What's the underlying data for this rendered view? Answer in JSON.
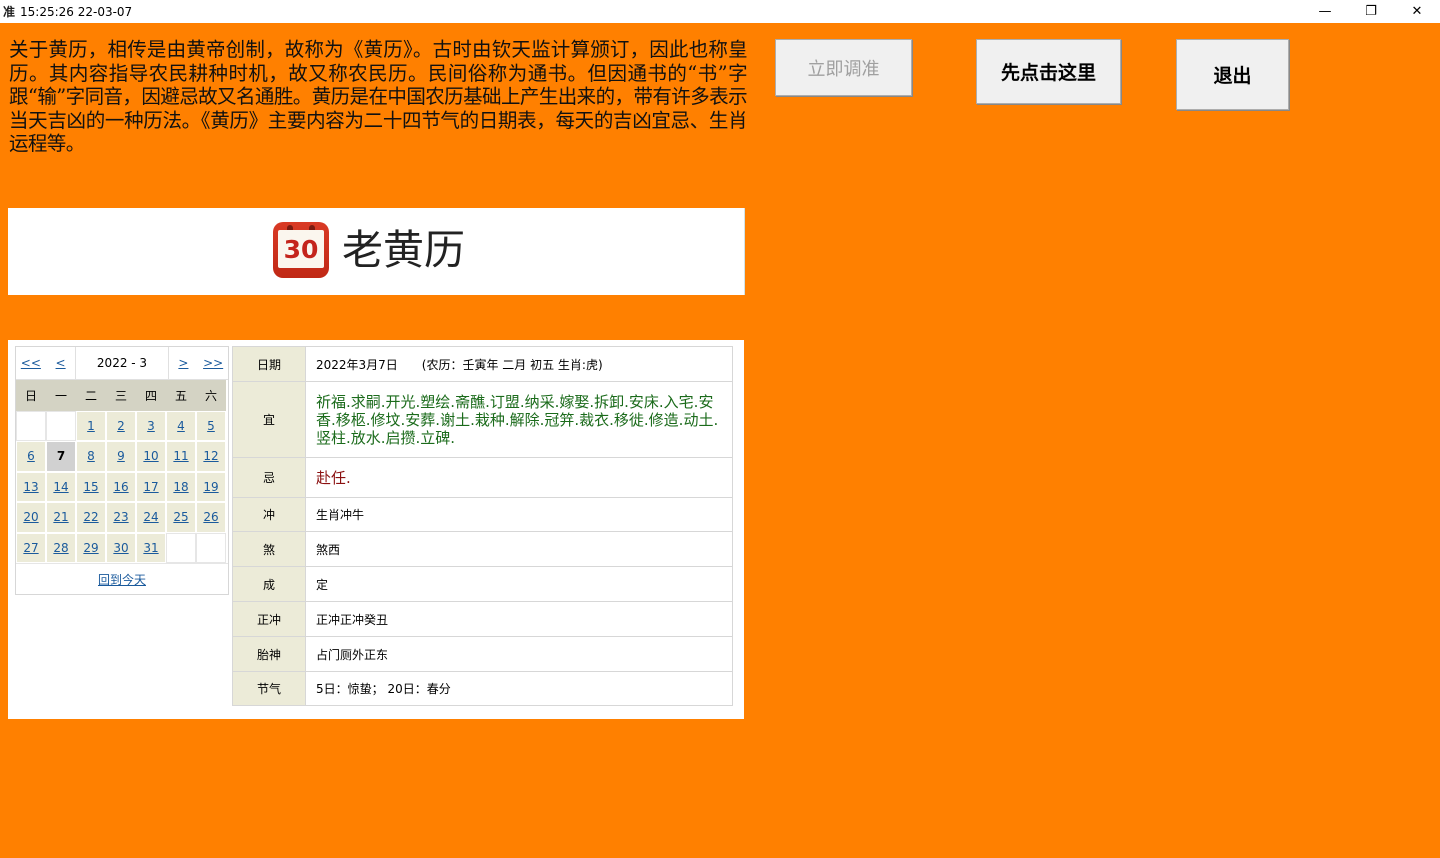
{
  "window": {
    "app_icon_text": "准",
    "title": "15:25:26 22-03-07",
    "controls": {
      "minimize": "—",
      "restore": "❐",
      "close": "✕"
    }
  },
  "description": "关于黄历，相传是由黄帝创制，故称为《黄历》。古时由钦天监计算颁订，因此也称皇历。其内容指导农民耕种时机，故又称农民历。民间俗称为通书。但因通书的“书”字跟“输”字同音，因避忌故又名通胜。黄历是在中国农历基础上产生出来的，带有许多表示当天吉凶的一种历法。《黄历》主要内容为二十四节气的日期表，每天的吉凶宜忌、生肖运程等。",
  "buttons": {
    "calibrate": "立即调准",
    "click_here": "先点击这里",
    "exit": "退出"
  },
  "header": {
    "logo_number": "30",
    "title": "老黄历"
  },
  "mini_calendar": {
    "nav": {
      "prev_year": "<<",
      "prev_month": "<",
      "current": "2022 - 3",
      "next_month": ">",
      "next_year": ">>"
    },
    "weekdays": [
      "日",
      "一",
      "二",
      "三",
      "四",
      "五",
      "六"
    ],
    "days": [
      "",
      "",
      "1",
      "2",
      "3",
      "4",
      "5",
      "6",
      "7",
      "8",
      "9",
      "10",
      "11",
      "12",
      "13",
      "14",
      "15",
      "16",
      "17",
      "18",
      "19",
      "20",
      "21",
      "22",
      "23",
      "24",
      "25",
      "26",
      "27",
      "28",
      "29",
      "30",
      "31",
      "",
      ""
    ],
    "today": "7",
    "back_to_today": "回到今天"
  },
  "almanac": {
    "date_label": "日期",
    "date_value": "2022年3月7日　　(农历：壬寅年 二月 初五 生肖:虎)",
    "yi_label": "宜",
    "yi_value": "祈福.求嗣.开光.塑绘.斋醮.订盟.纳采.嫁娶.拆卸.安床.入宅.安香.移柩.修坟.安葬.谢土.栽种.解除.冠笄.裁衣.移徙.修造.动土.竖柱.放水.启攒.立碑.",
    "ji_label": "忌",
    "ji_value": "赴任.",
    "chong_label": "冲",
    "chong_value": "生肖冲牛",
    "sha_label": "煞",
    "sha_value": "煞西",
    "cheng_label": "成",
    "cheng_value": "定",
    "zhengchong_label": "正冲",
    "zhengchong_value": "正冲正冲癸丑",
    "taishen_label": "胎神",
    "taishen_value": "占门厕外正东",
    "jieqi_label": "节气",
    "jieqi_value": "5日：惊蛰；  20日：春分"
  }
}
